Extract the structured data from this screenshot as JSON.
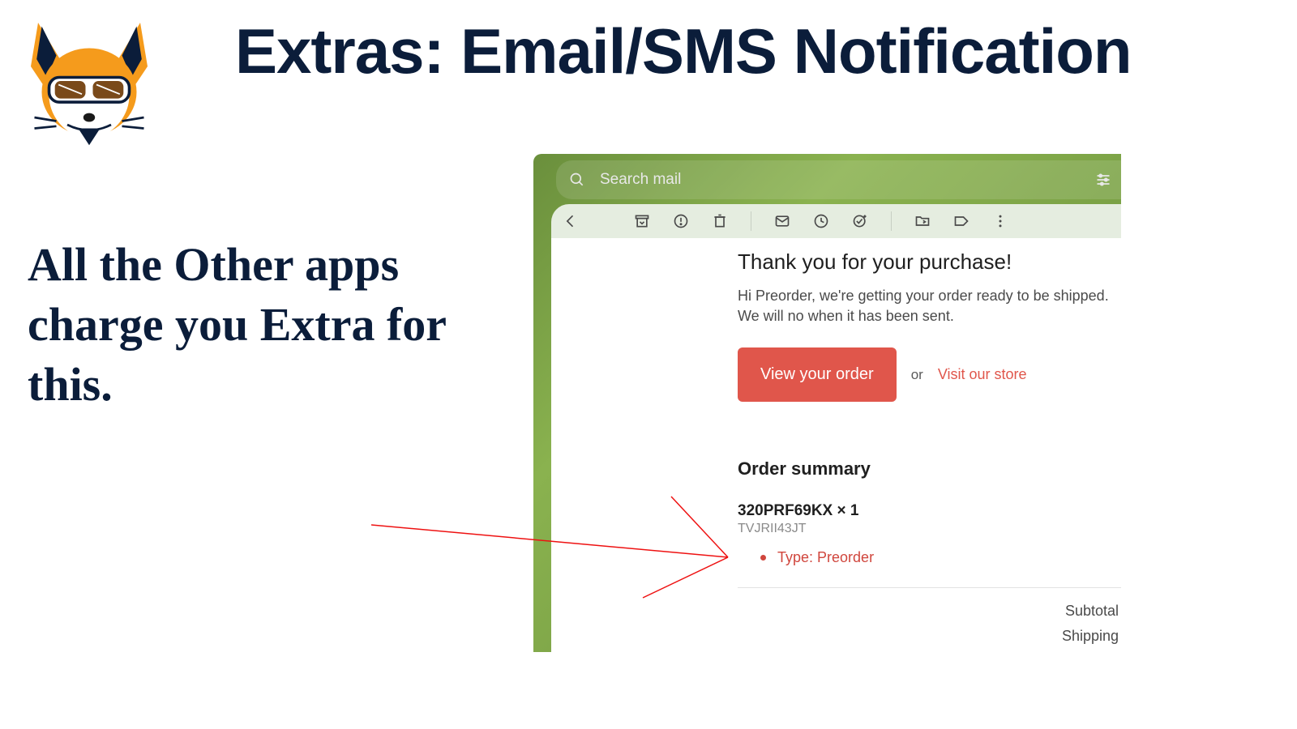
{
  "slide": {
    "title": "Extras: Email/SMS Notification",
    "copy": "All the Other apps charge you Extra for this."
  },
  "mail": {
    "search_placeholder": "Search mail",
    "subject": "Thank you for your purchase!",
    "intro": "Hi Preorder, we're getting your order ready to be shipped. We will no when it has been sent.",
    "cta_button": "View your order",
    "or_text": "or",
    "store_link": "Visit our store",
    "summary_heading": "Order summary",
    "order_item": "320PRF69KX × 1",
    "order_sku": "TVJRII43JT",
    "order_bullet": "Type: Preorder",
    "subtotal_label": "Subtotal",
    "shipping_label": "Shipping"
  }
}
